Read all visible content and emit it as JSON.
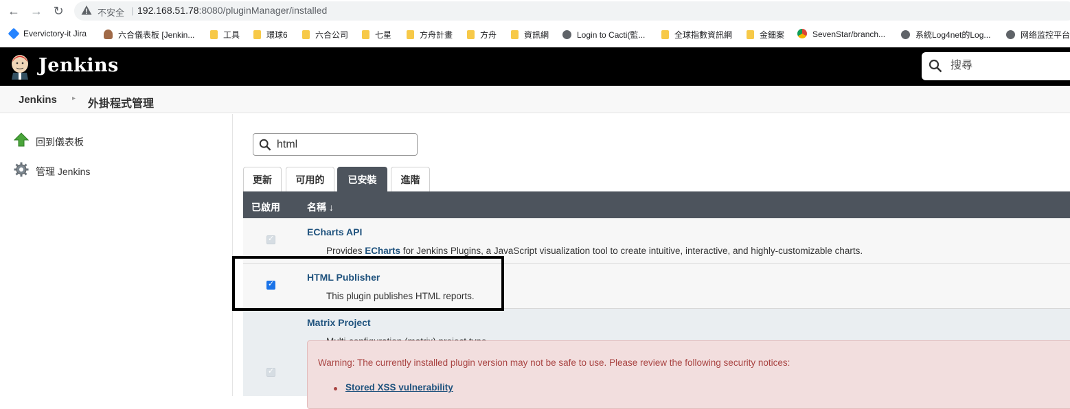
{
  "browser": {
    "insecure_label": "不安全",
    "url_host": "192.168.51.78",
    "url_rest": ":8080/pluginManager/installed",
    "bookmarks": [
      {
        "label": "Evervictory-it Jira",
        "icon": "jira-icon"
      },
      {
        "label": "六合儀表板 [Jenkin...",
        "icon": "avatar-icon"
      },
      {
        "label": "工具",
        "icon": "folder-icon"
      },
      {
        "label": "環球6",
        "icon": "folder-icon"
      },
      {
        "label": "六合公司",
        "icon": "folder-icon"
      },
      {
        "label": "七星",
        "icon": "folder-icon"
      },
      {
        "label": "方舟計畫",
        "icon": "folder-icon"
      },
      {
        "label": "方舟",
        "icon": "folder-icon"
      },
      {
        "label": "資訊網",
        "icon": "folder-icon"
      },
      {
        "label": "Login to Cacti(監...",
        "icon": "globe-icon"
      },
      {
        "label": "全球指數資訊網",
        "icon": "folder-icon"
      },
      {
        "label": "金鈿案",
        "icon": "folder-icon"
      },
      {
        "label": "SevenStar/branch...",
        "icon": "chrome-icon"
      },
      {
        "label": "系統Log4net的Log...",
        "icon": "globe-icon"
      },
      {
        "label": "网络监控平台",
        "icon": "globe-icon"
      }
    ]
  },
  "header": {
    "title": "Jenkins",
    "search_placeholder": "搜尋"
  },
  "breadcrumb": {
    "root": "Jenkins",
    "current": "外掛程式管理"
  },
  "sidebar": {
    "items": [
      {
        "label": "回到儀表板",
        "icon": "up-arrow-icon"
      },
      {
        "label": "管理 Jenkins",
        "icon": "gear-icon"
      }
    ]
  },
  "main": {
    "filter_value": "html",
    "tabs": [
      {
        "label": "更新"
      },
      {
        "label": "可用的"
      },
      {
        "label": "已安裝"
      },
      {
        "label": "進階"
      }
    ],
    "active_tab": "已安裝",
    "columns": {
      "enabled": "已啟用",
      "name": "名稱 ↓"
    },
    "plugins": [
      {
        "name": "ECharts API",
        "desc_prefix": "Provides ",
        "desc_link": "ECharts",
        "desc_suffix": " for Jenkins Plugins, a JavaScript visualization tool to create intuitive, interactive, and highly-customizable charts.",
        "enabled": true,
        "editable": false
      },
      {
        "name": "HTML Publisher",
        "desc": "This plugin publishes HTML reports.",
        "enabled": true,
        "editable": true
      },
      {
        "name": "Matrix Project",
        "desc": "Multi-configuration (matrix) project type.",
        "enabled": true,
        "editable": false,
        "warning": "Warning: The currently installed plugin version may not be safe to use. Please review the following security notices:",
        "warning_link": "Stored XSS vulnerability"
      }
    ]
  }
}
